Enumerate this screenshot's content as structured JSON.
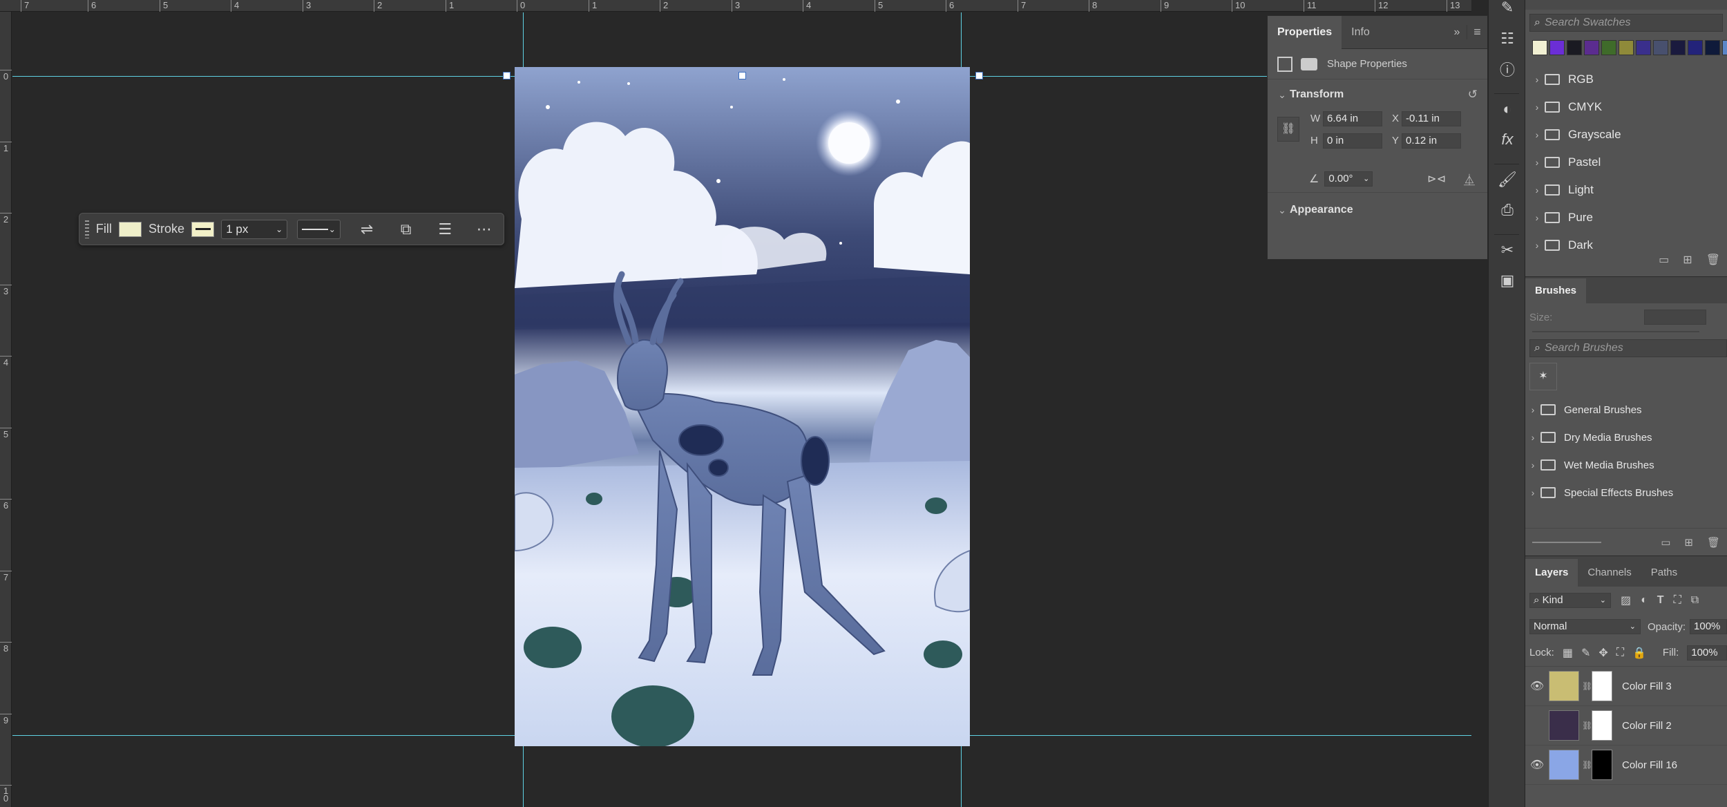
{
  "rulers": {
    "top": [
      "7",
      "6",
      "5",
      "4",
      "3",
      "2",
      "1",
      "0",
      "1",
      "2",
      "3",
      "4",
      "5",
      "6",
      "7",
      "8",
      "9",
      "10",
      "11",
      "12",
      "13"
    ],
    "left": [
      "0",
      "1",
      "2",
      "3",
      "4",
      "5",
      "6",
      "7",
      "8",
      "9",
      "1\n0"
    ]
  },
  "context_bar": {
    "fill_label": "Fill",
    "fill_color": "#efefc9",
    "stroke_label": "Stroke",
    "stroke_width": "1 px",
    "icons": [
      "align-icon",
      "arrange-icon",
      "adjust-icon",
      "more-icon"
    ]
  },
  "properties": {
    "tabs": [
      "Properties",
      "Info"
    ],
    "kind": "Shape Properties",
    "transform_title": "Transform",
    "w_label": "W",
    "w_value": "6.64 in",
    "x_label": "X",
    "x_value": "-0.11 in",
    "h_label": "H",
    "h_value": "0 in",
    "y_label": "Y",
    "y_value": "0.12 in",
    "angle_value": "0.00°",
    "appearance_title": "Appearance"
  },
  "swatches": {
    "search_placeholder": "Search Swatches",
    "colors": [
      "#f1f0d2",
      "#6b2ed6",
      "#1a1a22",
      "#5b2c8f",
      "#3f6b2a",
      "#8f8a3a",
      "#3a2f8c",
      "#48506e",
      "#1a1a3e",
      "#23237a",
      "#0f1a3a",
      "#5b86c8"
    ],
    "groups": [
      "RGB",
      "CMYK",
      "Grayscale",
      "Pastel",
      "Light",
      "Pure",
      "Dark"
    ]
  },
  "brushes": {
    "title": "Brushes",
    "size_label": "Size:",
    "search_placeholder": "Search Brushes",
    "groups": [
      "General Brushes",
      "Dry Media Brushes",
      "Wet Media Brushes",
      "Special Effects Brushes"
    ]
  },
  "layers": {
    "tabs": [
      "Layers",
      "Channels",
      "Paths"
    ],
    "filter": "Kind",
    "blend_mode": "Normal",
    "opacity_label": "Opacity:",
    "opacity_value": "100%",
    "lock_label": "Lock:",
    "fill_label": "Fill:",
    "fill_value": "100%",
    "items": [
      {
        "name": "Color Fill 3",
        "color": "#c9bd73",
        "visible": true,
        "mask": "#ffffff"
      },
      {
        "name": "Color Fill 2",
        "color": "#3a2e4a",
        "visible": false,
        "mask": "#ffffff"
      },
      {
        "name": "Color Fill 16",
        "color": "#8aa6e6",
        "visible": true,
        "mask": "#000000"
      }
    ]
  }
}
